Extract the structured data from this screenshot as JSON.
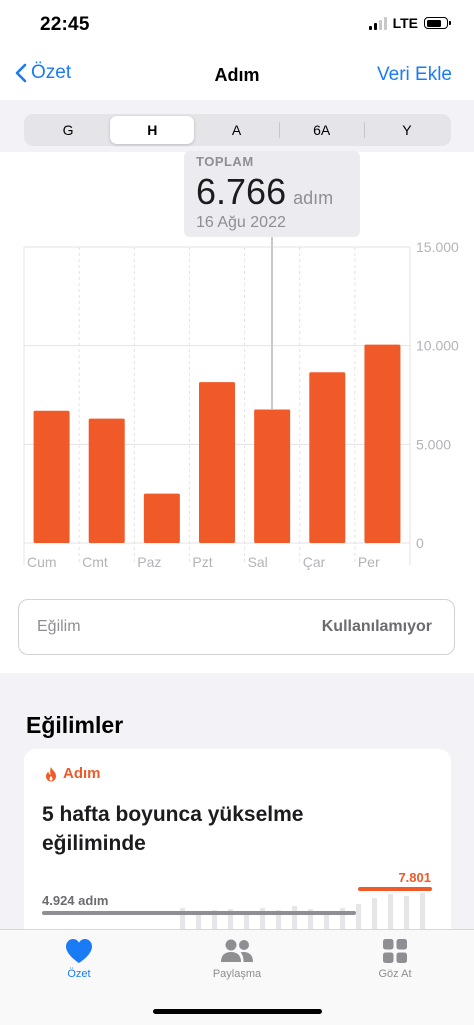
{
  "status_bar": {
    "time": "22:45",
    "network": "LTE"
  },
  "nav": {
    "back_label": "Özet",
    "title": "Adım",
    "add_label": "Veri Ekle"
  },
  "segments": [
    {
      "label": "G",
      "selected": false
    },
    {
      "label": "H",
      "selected": true
    },
    {
      "label": "A",
      "selected": false
    },
    {
      "label": "6A",
      "selected": false
    },
    {
      "label": "Y",
      "selected": false
    }
  ],
  "tooltip": {
    "label": "TOPLAM",
    "value": "6.766",
    "unit": "adım",
    "date": "16 Ağu 2022"
  },
  "chart_data": {
    "type": "bar",
    "categories": [
      "Cum",
      "Cmt",
      "Paz",
      "Pzt",
      "Sal",
      "Çar",
      "Per"
    ],
    "values": [
      6700,
      6300,
      2500,
      8150,
      6766,
      8650,
      10050
    ],
    "ylim": [
      0,
      15000
    ],
    "yticks": [
      15000,
      10000,
      5000,
      0
    ],
    "ytick_labels": [
      "15.000",
      "10.000",
      "5.000",
      "0"
    ],
    "highlighted_index": 4,
    "bar_color": "#f05a28",
    "grid": true
  },
  "trend": {
    "label": "Eğilim",
    "value": "Kullanılamıyor"
  },
  "trends_section": {
    "title": "Eğilimler",
    "card": {
      "category": "Adım",
      "headline": "5 hafta boyunca yükselme eğiliminde",
      "left_value": "4.924 adım",
      "right_value": "7.801"
    }
  },
  "tabbar": {
    "items": [
      {
        "label": "Özet",
        "icon": "heart-icon",
        "active": true
      },
      {
        "label": "Paylaşma",
        "icon": "people-icon",
        "active": false
      },
      {
        "label": "Göz At",
        "icon": "grid-icon",
        "active": false
      }
    ]
  },
  "colors": {
    "accent": "#1a7cf5",
    "bar": "#f05a28",
    "inactive": "#8e8e93"
  }
}
